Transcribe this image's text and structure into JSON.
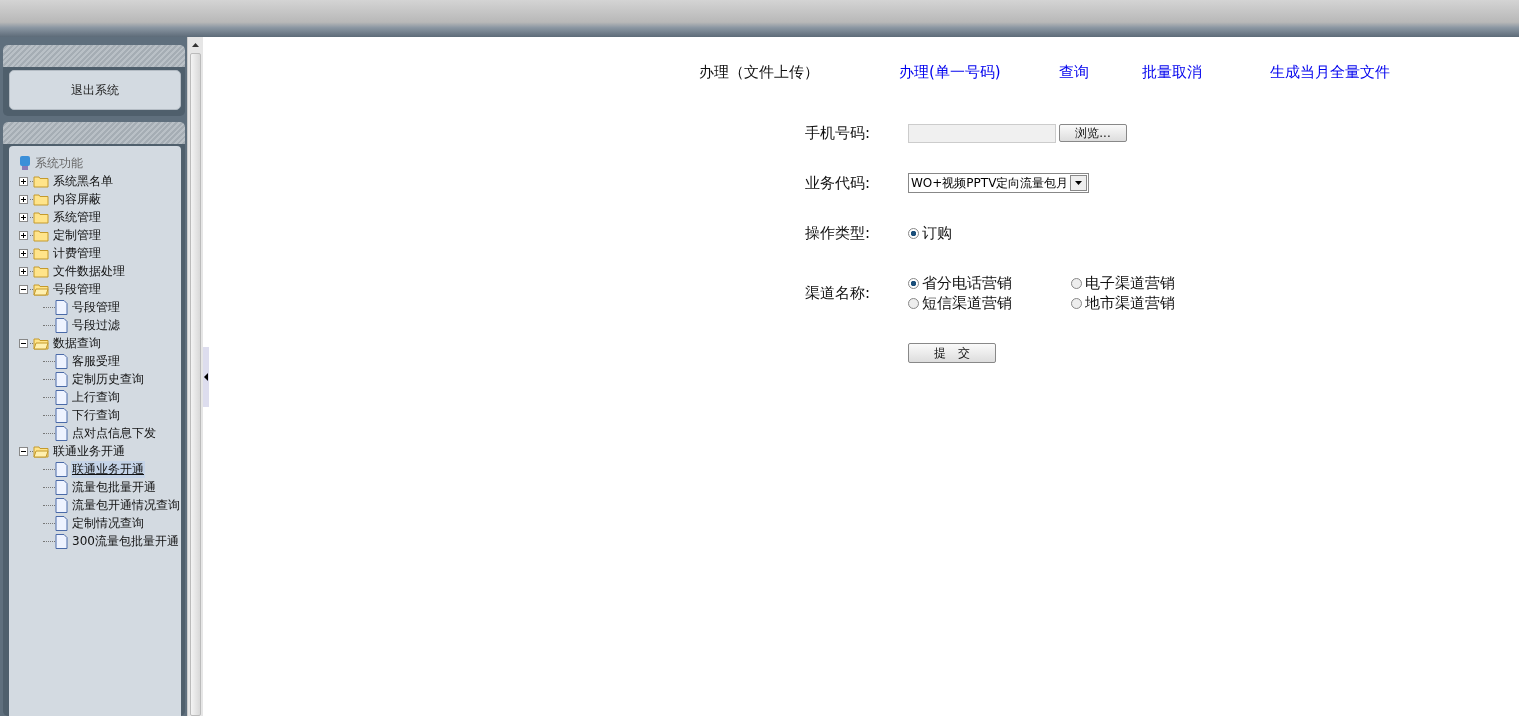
{
  "sidebar": {
    "logout_button": "退出系统",
    "tree": {
      "label": "系统功能",
      "children": [
        {
          "label": "系统黑名单",
          "expanded": false
        },
        {
          "label": "内容屏蔽",
          "expanded": false
        },
        {
          "label": "系统管理",
          "expanded": false
        },
        {
          "label": "定制管理",
          "expanded": false
        },
        {
          "label": "计费管理",
          "expanded": false
        },
        {
          "label": "文件数据处理",
          "expanded": false
        },
        {
          "label": "号段管理",
          "expanded": true,
          "children": [
            {
              "label": "号段管理",
              "selected": false
            },
            {
              "label": "号段过滤",
              "selected": false
            }
          ]
        },
        {
          "label": "数据查询",
          "expanded": true,
          "children": [
            {
              "label": "客服受理",
              "selected": false
            },
            {
              "label": "定制历史查询",
              "selected": false
            },
            {
              "label": "上行查询",
              "selected": false
            },
            {
              "label": "下行查询",
              "selected": false
            },
            {
              "label": "点对点信息下发",
              "selected": false
            }
          ]
        },
        {
          "label": "联通业务开通",
          "expanded": true,
          "children": [
            {
              "label": "联通业务开通",
              "selected": true
            },
            {
              "label": "流量包批量开通",
              "selected": false
            },
            {
              "label": "流量包开通情况查询",
              "selected": false
            },
            {
              "label": "定制情况查询",
              "selected": false
            },
            {
              "label": "300流量包批量开通",
              "selected": false
            }
          ]
        }
      ]
    }
  },
  "tabs": [
    {
      "label": "办理（文件上传）",
      "selected": true
    },
    {
      "label": "办理(单一号码)",
      "selected": false
    },
    {
      "label": "查询",
      "selected": false
    },
    {
      "label": "批量取消",
      "selected": false
    },
    {
      "label": "生成当月全量文件",
      "selected": false
    }
  ],
  "form": {
    "rows": [
      {
        "kind": "file",
        "label": "手机号码:",
        "button": "浏览..."
      },
      {
        "kind": "select",
        "label": "业务代码:",
        "value": "WO+视频PPTV定向流量包月"
      },
      {
        "kind": "radio",
        "label": "操作类型:",
        "options": [
          {
            "label": "订购",
            "selected": true
          }
        ]
      },
      {
        "kind": "radio",
        "label": "渠道名称:",
        "options": [
          {
            "label": "省分电话营销",
            "selected": true
          },
          {
            "label": "电子渠道营销",
            "selected": false
          },
          {
            "label": "短信渠道营销",
            "selected": false
          },
          {
            "label": "地市渠道营销",
            "selected": false
          }
        ]
      }
    ],
    "submit": "提　交"
  }
}
